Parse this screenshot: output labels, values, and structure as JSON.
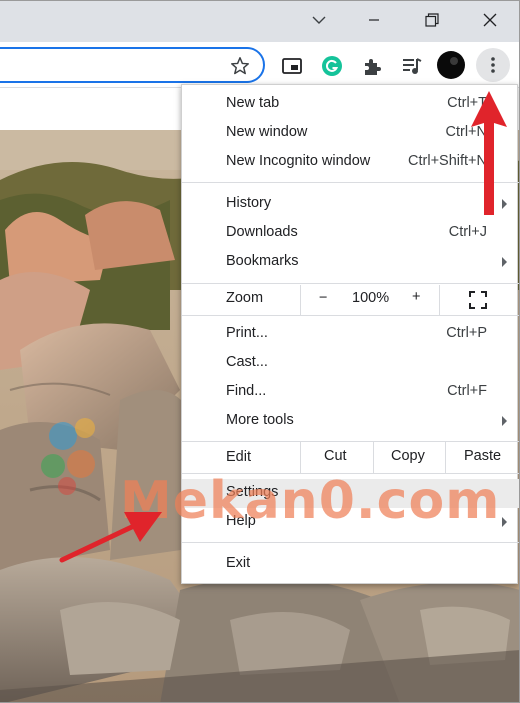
{
  "window": {
    "controls": [
      "chevron-down",
      "minimize",
      "restore",
      "close"
    ]
  },
  "toolbar": {
    "icons": [
      "star-icon",
      "reading-mode-icon",
      "grammarly-icon",
      "extensions-icon",
      "media-queue-icon",
      "profile-avatar",
      "more-menu-icon"
    ]
  },
  "menu": {
    "new_tab": {
      "label": "New tab",
      "shortcut": "Ctrl+T"
    },
    "new_window": {
      "label": "New window",
      "shortcut": "Ctrl+N"
    },
    "new_incognito": {
      "label": "New Incognito window",
      "shortcut": "Ctrl+Shift+N"
    },
    "history": {
      "label": "History"
    },
    "downloads": {
      "label": "Downloads",
      "shortcut": "Ctrl+J"
    },
    "bookmarks": {
      "label": "Bookmarks"
    },
    "zoom": {
      "label": "Zoom",
      "minus": "−",
      "level": "100%",
      "plus": "+"
    },
    "print": {
      "label": "Print...",
      "shortcut": "Ctrl+P"
    },
    "cast": {
      "label": "Cast..."
    },
    "find": {
      "label": "Find...",
      "shortcut": "Ctrl+F"
    },
    "more_tools": {
      "label": "More tools"
    },
    "edit": {
      "label": "Edit",
      "cut": "Cut",
      "copy": "Copy",
      "paste": "Paste"
    },
    "settings": {
      "label": "Settings"
    },
    "help": {
      "label": "Help"
    },
    "exit": {
      "label": "Exit"
    }
  },
  "watermark": {
    "text": "Mekan0.com"
  },
  "colors": {
    "accent": "#1a73e8",
    "annotation_arrow": "#e0242b",
    "grammarly": "#15c39a"
  }
}
